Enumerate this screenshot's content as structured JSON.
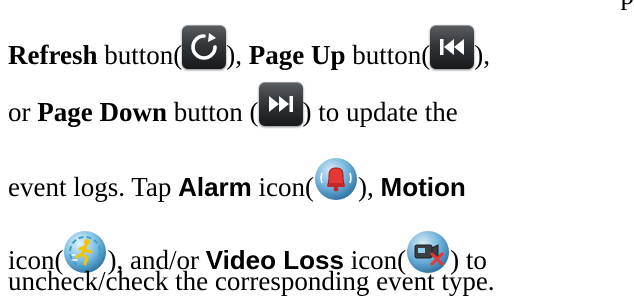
{
  "text": {
    "top_fragment": "p",
    "line1": {
      "refresh_label": "Refresh",
      "button_word_1": " button(",
      "close_comma_1": "), ",
      "pageup_label": "Page Up",
      "button_word_2": " button(",
      "close_comma_2": "),"
    },
    "line2": {
      "lead": "or ",
      "pagedown_label": "Page Down",
      "button_word_3": " button (",
      "tail": ") to update the"
    },
    "line3": {
      "lead": "event logs.  Tap ",
      "alarm_label": "Alarm",
      "icon_word_1": " icon(",
      "close_comma_3": "), ",
      "motion_label": "Motion"
    },
    "line4": {
      "icon_word_2": "icon(",
      "mid": "), and/or ",
      "videoloss_label": "Video Loss",
      "icon_word_3": " icon(",
      "tail": ") to"
    },
    "line5": "uncheck/check the corresponding event type."
  },
  "icons": {
    "refresh": "refresh-icon",
    "page_up": "skip-back-icon",
    "page_down": "skip-forward-icon",
    "alarm": "bell-icon",
    "motion": "running-man-icon",
    "video_loss": "camera-off-icon"
  },
  "colors": {
    "button_face": "#34373a",
    "glyph": "#ffffff",
    "alarm_red": "#e53935",
    "motion_yellow": "#f5c400",
    "motion_ring": "#3aa1c8",
    "orb_blue": "#3f8fc4"
  }
}
